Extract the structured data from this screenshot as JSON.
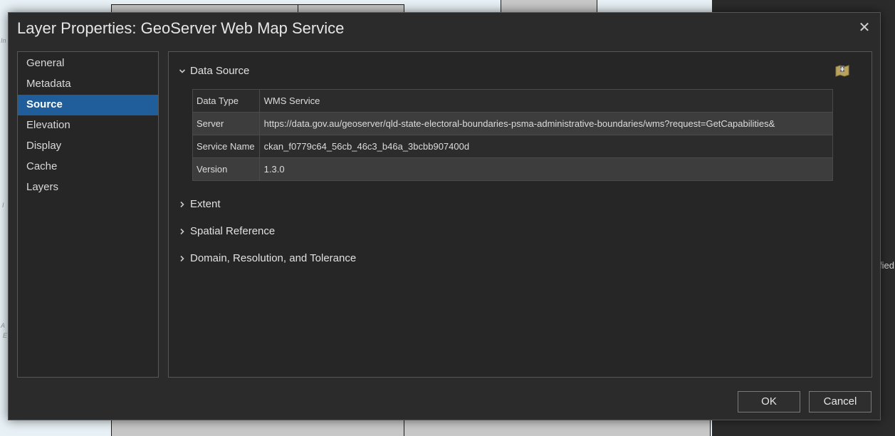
{
  "dialog": {
    "title": "Layer Properties: GeoServer Web Map Service",
    "close_glyph": "✕"
  },
  "sidebar": {
    "items": [
      {
        "label": "General"
      },
      {
        "label": "Metadata"
      },
      {
        "label": "Source",
        "selected": true
      },
      {
        "label": "Elevation"
      },
      {
        "label": "Display"
      },
      {
        "label": "Cache"
      },
      {
        "label": "Layers"
      }
    ]
  },
  "source": {
    "data_source": {
      "label": "Data Source",
      "expanded": true,
      "rows": [
        {
          "key": "Data Type",
          "value": "WMS Service"
        },
        {
          "key": "Server",
          "value": "https://data.gov.au/geoserver/qld-state-electoral-boundaries-psma-administrative-boundaries/wms?request=GetCapabilities&"
        },
        {
          "key": "Service Name",
          "value": "ckan_f0779c64_56cb_46c3_b46a_3bcbb907400d"
        },
        {
          "key": "Version",
          "value": "1.3.0"
        }
      ]
    },
    "sections": [
      {
        "label": "Extent",
        "expanded": false
      },
      {
        "label": "Spatial Reference",
        "expanded": false
      },
      {
        "label": "Domain, Resolution, and Tolerance",
        "expanded": false
      }
    ],
    "tool_icon": "set-data-source-icon"
  },
  "buttons": {
    "ok": "OK",
    "cancel": "Cancel"
  },
  "background": {
    "right_fragment": "fied",
    "left_fragments": [
      "In",
      "I",
      "A",
      "E"
    ]
  },
  "colors": {
    "accent": "#1f5d9b",
    "dialog_bg": "#2b2b2b",
    "panel_bg": "#262626"
  }
}
